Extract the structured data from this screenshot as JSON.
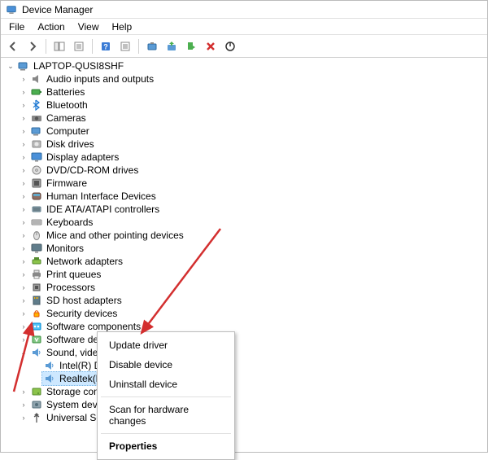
{
  "window": {
    "title": "Device Manager"
  },
  "menubar": {
    "items": [
      "File",
      "Action",
      "View",
      "Help"
    ]
  },
  "root": {
    "name": "LAPTOP-QUSI8SHF"
  },
  "categories": [
    {
      "label": "Audio inputs and outputs",
      "icon": "speaker"
    },
    {
      "label": "Batteries",
      "icon": "battery"
    },
    {
      "label": "Bluetooth",
      "icon": "bluetooth"
    },
    {
      "label": "Cameras",
      "icon": "camera"
    },
    {
      "label": "Computer",
      "icon": "computer"
    },
    {
      "label": "Disk drives",
      "icon": "disk"
    },
    {
      "label": "Display adapters",
      "icon": "display"
    },
    {
      "label": "DVD/CD-ROM drives",
      "icon": "dvd"
    },
    {
      "label": "Firmware",
      "icon": "firmware"
    },
    {
      "label": "Human Interface Devices",
      "icon": "hid"
    },
    {
      "label": "IDE ATA/ATAPI controllers",
      "icon": "ide"
    },
    {
      "label": "Keyboards",
      "icon": "keyboard"
    },
    {
      "label": "Mice and other pointing devices",
      "icon": "mouse"
    },
    {
      "label": "Monitors",
      "icon": "monitor"
    },
    {
      "label": "Network adapters",
      "icon": "network"
    },
    {
      "label": "Print queues",
      "icon": "printer"
    },
    {
      "label": "Processors",
      "icon": "cpu"
    },
    {
      "label": "SD host adapters",
      "icon": "sd"
    },
    {
      "label": "Security devices",
      "icon": "security"
    },
    {
      "label": "Software components",
      "icon": "swcomp"
    },
    {
      "label": "Software devices",
      "icon": "swdev"
    },
    {
      "label": "Sound, video and game controllers",
      "icon": "sound",
      "expanded": true,
      "children": [
        {
          "label": "Intel(R) Display Audio",
          "icon": "sound"
        },
        {
          "label": "Realtek(R) ",
          "icon": "sound",
          "selected": true
        }
      ]
    },
    {
      "label": "Storage con",
      "icon": "storage"
    },
    {
      "label": "System devi",
      "icon": "system"
    },
    {
      "label": "Universal Se",
      "icon": "usb"
    }
  ],
  "context_menu": {
    "items": [
      {
        "label": "Update driver"
      },
      {
        "label": "Disable device"
      },
      {
        "label": "Uninstall device"
      },
      {
        "sep": true
      },
      {
        "label": "Scan for hardware changes"
      },
      {
        "sep": true
      },
      {
        "label": "Properties",
        "bold": true
      }
    ]
  }
}
